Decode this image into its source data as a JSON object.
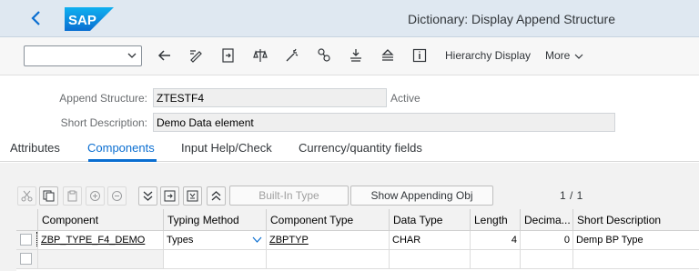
{
  "shell": {
    "title": "Dictionary: Display Append Structure",
    "logo_text": "SAP"
  },
  "toolbar": {
    "command_field_value": "",
    "icons": [
      "back-arrow-icon",
      "toggle-display-change-icon",
      "other-object-icon",
      "check-icon",
      "activate-icon",
      "where-used-icon",
      "object-list-icon",
      "info-icon"
    ],
    "hierarchy_label": "Hierarchy Display",
    "more_label": "More"
  },
  "header": {
    "append_structure_label": "Append Structure:",
    "append_structure_value": "ZTESTF4",
    "status": "Active",
    "short_description_label": "Short Description:",
    "short_description_value": "Demo Data element"
  },
  "tabs": [
    {
      "label": "Attributes",
      "active": false
    },
    {
      "label": "Components",
      "active": true
    },
    {
      "label": "Input Help/Check",
      "active": false
    },
    {
      "label": "Currency/quantity fields",
      "active": false
    }
  ],
  "table_toolbar": {
    "builtin_type_label": "Built-In Type",
    "show_appending_label": "Show Appending Obj",
    "pager": "1 / 1"
  },
  "grid": {
    "columns": [
      "Component",
      "Typing Method",
      "Component Type",
      "Data Type",
      "Length",
      "Decima...",
      "Short Description"
    ],
    "rows": [
      {
        "component": "ZBP_TYPE_F4_DEMO",
        "typing_method": "Types",
        "component_type": "ZBPTYP",
        "data_type": "CHAR",
        "length": "4",
        "decimals": "0",
        "short_description": "Demp BP Type"
      },
      {
        "component": "",
        "typing_method": "",
        "component_type": "",
        "data_type": "",
        "length": "",
        "decimals": "",
        "short_description": ""
      }
    ]
  },
  "colors": {
    "shell_bg": "#dfe8f1",
    "accent": "#0a6ed1",
    "sap_blue": "#0a7bd0"
  }
}
